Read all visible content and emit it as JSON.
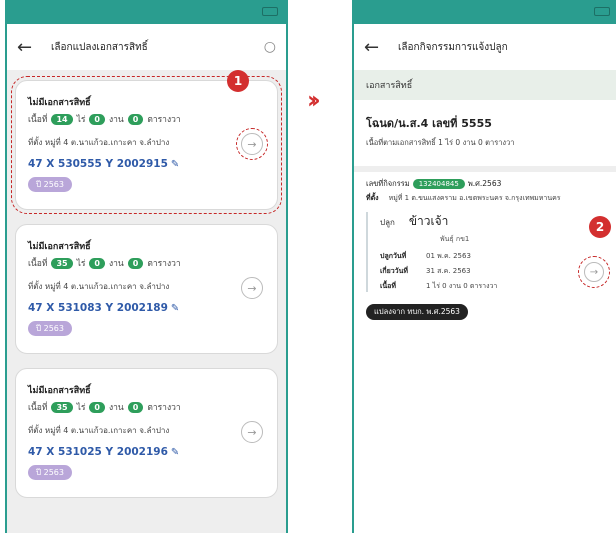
{
  "left": {
    "title": "เลือกแปลงเอกสารสิทธิ์",
    "cards": [
      {
        "head": "ไม่มีเอกสารสิทธิ์",
        "area_prefix": "เนื้อที่",
        "rai": "14",
        "rai_unit": "ไร่",
        "ngan": "0",
        "ngan_unit": "งาน",
        "wa": "0",
        "wa_unit": "ตารางวา",
        "location": "ที่ตั้ง หมู่ที่ 4 ต.นาแก้วอ.เกาะคา จ.ลำปาง",
        "coord": "47 X 530555 Y 2002915",
        "year": "ปี 2563"
      },
      {
        "head": "ไม่มีเอกสารสิทธิ์",
        "area_prefix": "เนื้อที่",
        "rai": "35",
        "rai_unit": "ไร่",
        "ngan": "0",
        "ngan_unit": "งาน",
        "wa": "0",
        "wa_unit": "ตารางวา",
        "location": "ที่ตั้ง หมู่ที่ 4 ต.นาแก้วอ.เกาะคา จ.ลำปาง",
        "coord": "47 X 531083 Y 2002189",
        "year": "ปี 2563"
      },
      {
        "head": "ไม่มีเอกสารสิทธิ์",
        "area_prefix": "เนื้อที่",
        "rai": "35",
        "rai_unit": "ไร่",
        "ngan": "0",
        "ngan_unit": "งาน",
        "wa": "0",
        "wa_unit": "ตารางวา",
        "location": "ที่ตั้ง หมู่ที่ 4 ต.นาแก้วอ.เกาะคา จ.ลำปาง",
        "coord": "47 X 531025 Y 2002196",
        "year": "ปี 2563"
      }
    ]
  },
  "markers": {
    "one": "1",
    "two": "2"
  },
  "right": {
    "title": "เลือกกิจกรรมการแจ้งปลูก",
    "section": "เอกสารสิทธิ์",
    "doc_title": "โฉนด/น.ส.4 เลขที่ 5555",
    "doc_sub": "เนื้อที่ตามเอกสารสิทธิ์ 1 ไร่ 0 งาน 0 ตารางวา",
    "activity_label": "เลขที่กิจกรรม",
    "activity_id": "132404845",
    "activity_year": "พ.ศ.2563",
    "location_key": "ที่ตั้ง",
    "location_val": "หมู่ที่ 1 ต.ขนแสงคราม อ.เขตพระนคร จ.กรุงเทพมหานคร",
    "crop_key": "ปลูก",
    "crop_val": "ข้าวเจ้า",
    "variety": "พันธุ์ กข1",
    "plant_key": "ปลูกวันที่",
    "plant_val": "01 พ.ค. 2563",
    "harvest_key": "เกี่ยววันที่",
    "harvest_val": "31 ส.ค. 2563",
    "area_key": "เนื้อที่",
    "area_val": "1 ไร่ 0 งาน 0 ตารางวา",
    "tag": "แปลงจาก ทบก. พ.ศ.2563"
  },
  "colors": {
    "accent": "#2a9d8f",
    "pill_green": "#2e9e5b",
    "coord_blue": "#2f5aa8",
    "marker_red": "#d32f2f",
    "year_purple": "#b9a6d9"
  }
}
